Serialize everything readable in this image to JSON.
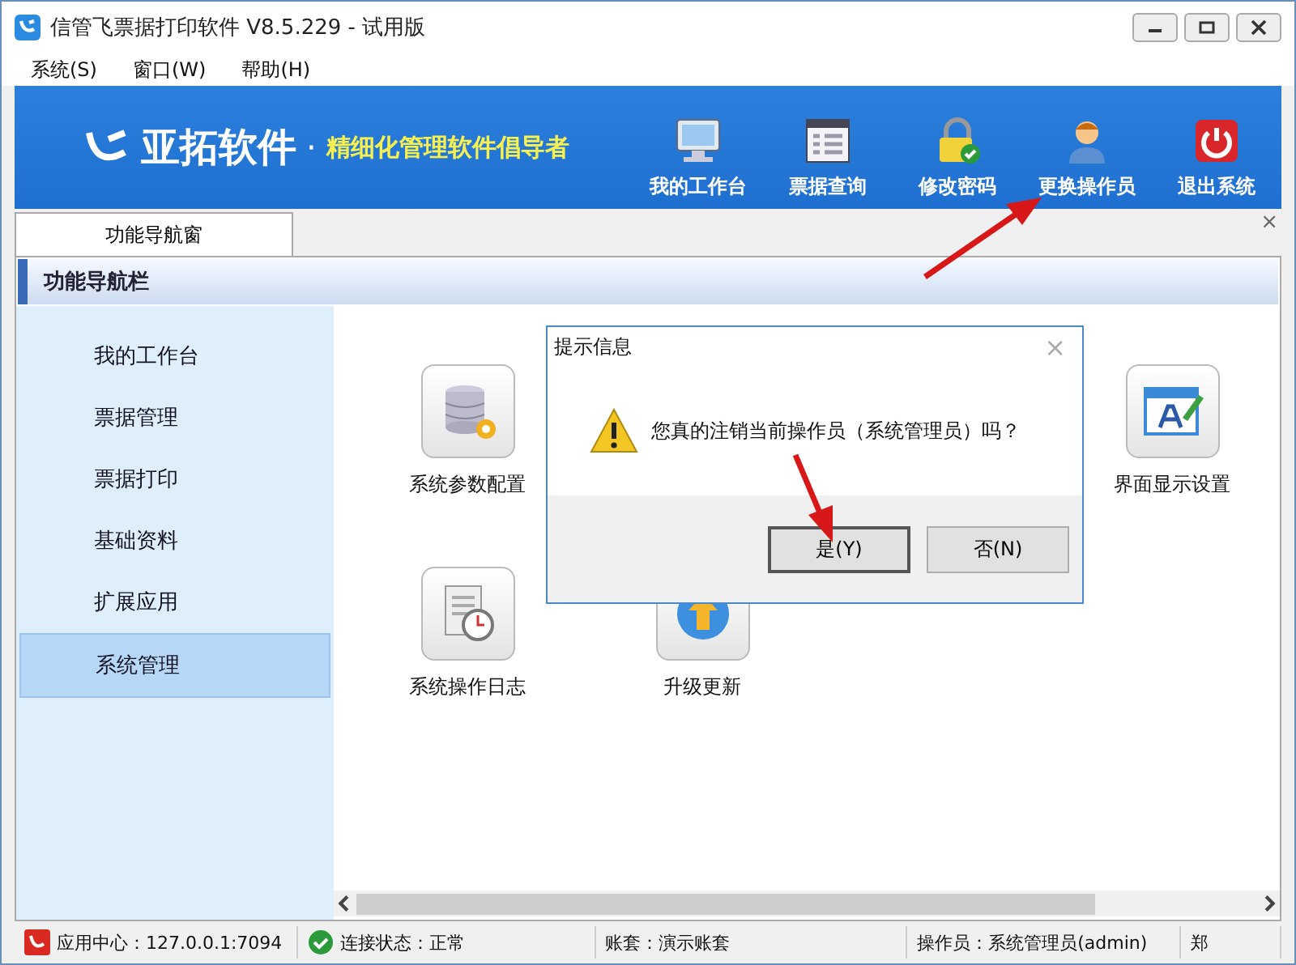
{
  "window": {
    "title": "信管飞票据打印软件 V8.5.229 - 试用版"
  },
  "menu": [
    "系统(S)",
    "窗口(W)",
    "帮助(H)"
  ],
  "banner": {
    "brand": "亚拓软件",
    "dot": "·",
    "slogan": "精细化管理软件倡导者"
  },
  "toolbar": [
    {
      "label": "我的工作台",
      "kind": "monitor"
    },
    {
      "label": "票据查询",
      "kind": "list"
    },
    {
      "label": "修改密码",
      "kind": "lock"
    },
    {
      "label": "更换操作员",
      "kind": "user"
    },
    {
      "label": "退出系统",
      "kind": "power"
    }
  ],
  "tabs": [
    {
      "label": "功能导航窗",
      "selected": true
    }
  ],
  "tab_close": "×",
  "nav": {
    "title": "功能导航栏",
    "items": [
      {
        "label": "我的工作台",
        "selected": false
      },
      {
        "label": "票据管理",
        "selected": false
      },
      {
        "label": "票据打印",
        "selected": false
      },
      {
        "label": "基础资料",
        "selected": false
      },
      {
        "label": "扩展应用",
        "selected": false
      },
      {
        "label": "系统管理",
        "selected": true
      }
    ]
  },
  "content": {
    "rows": [
      [
        {
          "label": "系统参数配置",
          "kind": "database"
        },
        null,
        null,
        {
          "label": "界面显示设置",
          "kind": "window"
        }
      ],
      [
        {
          "label": "系统操作日志",
          "kind": "clock"
        },
        {
          "label": "升级更新",
          "kind": "upload"
        }
      ]
    ]
  },
  "dialog": {
    "title": "提示信息",
    "close": "×",
    "message": "您真的注销当前操作员（系统管理员）吗？",
    "buttons": [
      {
        "label": "是(Y)",
        "selected": true
      },
      {
        "label": "否(N)",
        "selected": false
      }
    ]
  },
  "status_bar": [
    {
      "text": "应用中心：127.0.0.1:7094",
      "kind": "app"
    },
    {
      "text": "连接状态：正常",
      "kind": "ok"
    },
    {
      "text": "账套：演示账套",
      "kind": "plain"
    },
    {
      "text": "操作员：系统管理员(admin)",
      "kind": "plain"
    },
    {
      "text": "郑",
      "kind": "plain"
    }
  ]
}
